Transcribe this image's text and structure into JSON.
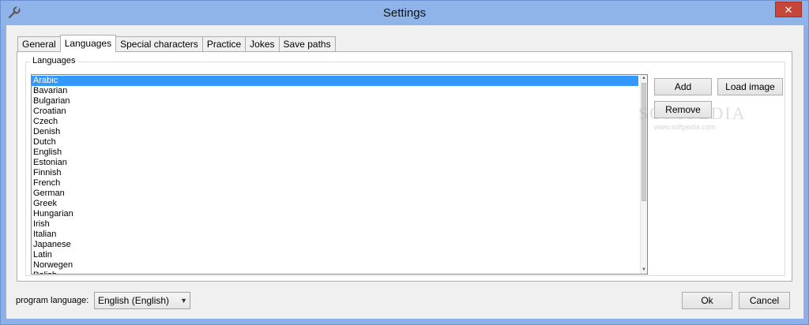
{
  "window": {
    "title": "Settings",
    "close_glyph": "✕"
  },
  "tabs": [
    {
      "label": "General"
    },
    {
      "label": "Languages"
    },
    {
      "label": "Special characters"
    },
    {
      "label": "Practice"
    },
    {
      "label": "Jokes"
    },
    {
      "label": "Save paths"
    }
  ],
  "languages_group": {
    "label": "Languages",
    "items": [
      "Arabic",
      "Bavarian",
      "Bulgarian",
      "Croatian",
      "Czech",
      "Denish",
      "Dutch",
      "English",
      "Estonian",
      "Finnish",
      "French",
      "German",
      "Greek",
      "Hungarian",
      "Irish",
      "Italian",
      "Japanese",
      "Latin",
      "Norwegen",
      "Polish"
    ],
    "selected_index": 0,
    "add_label": "Add",
    "remove_label": "Remove",
    "load_image_label": "Load image"
  },
  "watermark": {
    "text": "SOFTPEDIA",
    "sub": "www.softpedia.com"
  },
  "footer": {
    "program_language_label": "program language:",
    "program_language_value": "English (English)",
    "ok_label": "Ok",
    "cancel_label": "Cancel"
  },
  "colors": {
    "selection": "#3399ff",
    "title_bar": "#8fb4ea",
    "close_button": "#c7463a"
  }
}
